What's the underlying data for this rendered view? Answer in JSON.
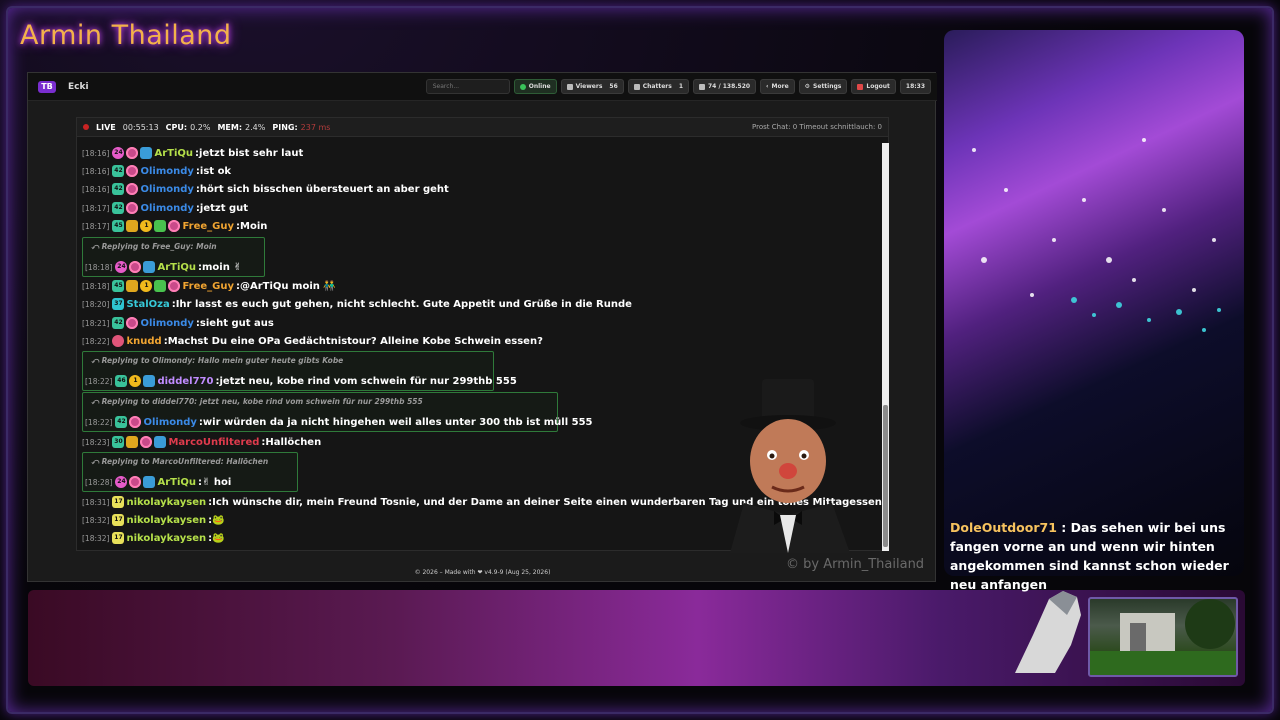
{
  "overlay": {
    "channel_title": "Armin Thailand",
    "watermark": "© by Armin_Thailand"
  },
  "app": {
    "name": "Ecki",
    "search_placeholder": "Search...",
    "buttons": {
      "online": "Online",
      "viewers_label": "Viewers",
      "viewers_count": "56",
      "chatters_label": "Chatters",
      "chatters_count": "1",
      "messages": "74 / 138.520",
      "more": "More",
      "settings": "Settings",
      "logout": "Logout",
      "clock": "18:33"
    },
    "status": {
      "live_label": "LIVE",
      "live_time": "00:55:13",
      "cpu_label": "CPU:",
      "cpu_value": "0.2%",
      "mem_label": "MEM:",
      "mem_value": "2.4%",
      "ping_label": "PING:",
      "ping_value": "237 ms",
      "right": "Prost Chat: 0  Timeout schnittlauch: 0"
    },
    "footer": "© 2026 – Made with ❤ v4.9-9 (Aug 25, 2026)"
  },
  "colors": {
    "artiqu": "#b5e04a",
    "olimondy": "#3b8ae6",
    "free_guy": "#f0a431",
    "staloza": "#37c9d8",
    "knudd": "#f0a431",
    "diddel": "#c08cff",
    "marco": "#e03b4d",
    "nikolay": "#b5e04a"
  },
  "chat": {
    "m1": {
      "ts": "[18:16]",
      "user": "ArTiQu",
      "text": "jetzt bist sehr laut",
      "badge1": "24"
    },
    "m2": {
      "ts": "[18:16]",
      "user": "Olimondy",
      "text": "ist ok",
      "badge1": "42"
    },
    "m3": {
      "ts": "[18:16]",
      "user": "Olimondy",
      "text": "hört sich bisschen übersteuert an aber geht",
      "badge1": "42"
    },
    "m4": {
      "ts": "[18:17]",
      "user": "Olimondy",
      "text": "jetzt gut",
      "badge1": "42"
    },
    "m5": {
      "ts": "[18:17]",
      "user": "Free_Guy",
      "text": "Moin",
      "badge1": "45",
      "coin": "1"
    },
    "r1": {
      "reply": "Replying to Free_Guy: Moin",
      "ts": "[18:18]",
      "user": "ArTiQu",
      "text": "moin ✌",
      "badge1": "24"
    },
    "m6": {
      "ts": "[18:18]",
      "user": "Free_Guy",
      "text": "@ArTiQu moin 👬",
      "badge1": "45",
      "coin": "1"
    },
    "m7": {
      "ts": "[18:20]",
      "user": "StalOza",
      "text": "Ihr lasst es euch gut gehen, nicht schlecht. Gute Appetit und Grüße in die Runde",
      "badge1": "37"
    },
    "m8": {
      "ts": "[18:21]",
      "user": "Olimondy",
      "text": "sieht gut aus",
      "badge1": "42"
    },
    "m9": {
      "ts": "[18:22]",
      "user": "knudd",
      "text": "Machst Du eine OPa Gedächtnistour? Alleine Kobe Schwein essen?"
    },
    "r2": {
      "reply": "Replying to Olimondy: Hallo mein guter heute gibts Kobe",
      "ts": "[18:22]",
      "user": "diddel770",
      "text": "jetzt neu, kobe rind vom schwein für nur 299thb 555",
      "badge1": "46",
      "coin": "1"
    },
    "r3": {
      "reply": "Replying to diddel770: jetzt neu, kobe rind vom schwein für nur 299thb 555",
      "ts": "[18:22]",
      "user": "Olimondy",
      "text": "wir würden da ja nicht hingehen weil alles unter 300 thb ist müll 555",
      "badge1": "42"
    },
    "m10": {
      "ts": "[18:23]",
      "user": "MarcoUnfiltered",
      "text": "Hallöchen",
      "badge1": "30"
    },
    "r4": {
      "reply": "Replying to MarcoUnfiltered: Hallöchen",
      "ts": "[18:28]",
      "user": "ArTiQu",
      "text": "✌ hoi",
      "badge1": "24"
    },
    "m11": {
      "ts": "[18:31]",
      "user": "nikolaykaysen",
      "text": "Ich wünsche dir, mein Freund Tosnie, und der Dame an deiner Seite einen wunderbaren Tag und ein tolles Mittagessen. 🍃🐸🐸",
      "badge1": "17"
    },
    "m12": {
      "ts": "[18:32]",
      "user": "nikolaykaysen",
      "text": "🐸",
      "badge1": "17"
    },
    "m13": {
      "ts": "[18:32]",
      "user": "nikolaykaysen",
      "text": "🐸",
      "badge1": "17"
    }
  },
  "side_overlay": {
    "user": "DoleOutdoor71",
    "sep": " : ",
    "text": "Das sehen wir bei uns fangen vorne an und wenn wir hinten angekommen sind kannst schon wieder neu anfangen"
  }
}
